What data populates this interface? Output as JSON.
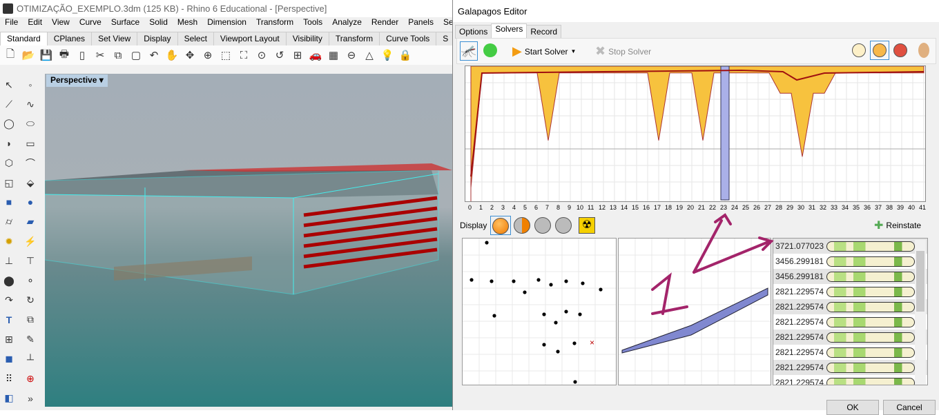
{
  "rhino": {
    "title": "OTIMIZAÇÃO_EXEMPLO.3dm (125 KB) - Rhino 6 Educational - [Perspective]",
    "menu": [
      "File",
      "Edit",
      "View",
      "Curve",
      "Surface",
      "Solid",
      "Mesh",
      "Dimension",
      "Transform",
      "Tools",
      "Analyze",
      "Render",
      "Panels",
      "Secti"
    ],
    "tabs": [
      "Standard",
      "CPlanes",
      "Set View",
      "Display",
      "Select",
      "Viewport Layout",
      "Visibility",
      "Transform",
      "Curve Tools",
      "S"
    ],
    "viewport_label": "Perspective"
  },
  "galapagos": {
    "title": "Galapagos Editor",
    "tabs": [
      "Options",
      "Solvers",
      "Record"
    ],
    "active_tab": "Solvers",
    "start_solver": "Start Solver",
    "stop_solver": "Stop Solver",
    "display_label": "Display",
    "reinstate": "Reinstate",
    "ok": "OK",
    "cancel": "Cancel",
    "generations": [
      "0",
      "1",
      "2",
      "3",
      "4",
      "5",
      "6",
      "7",
      "8",
      "9",
      "10",
      "11",
      "12",
      "13",
      "14",
      "15",
      "16",
      "17",
      "18",
      "19",
      "20",
      "21",
      "22",
      "23",
      "24",
      "25",
      "26",
      "27",
      "28",
      "29",
      "30",
      "31",
      "32",
      "33",
      "34",
      "35",
      "36",
      "37",
      "38",
      "39",
      "40",
      "41"
    ],
    "selected_generation": "23",
    "fitness_list": [
      "3721.077023",
      "3456.299181",
      "3456.299181",
      "2821.229574",
      "2821.229574",
      "2821.229574",
      "2821.229574",
      "2821.229574",
      "2821.229574",
      "2821.229574"
    ],
    "annotation": "1",
    "colors": {
      "accent": "#f39c12",
      "selection": "#aab0e8",
      "annotation": "#a3246a"
    }
  }
}
